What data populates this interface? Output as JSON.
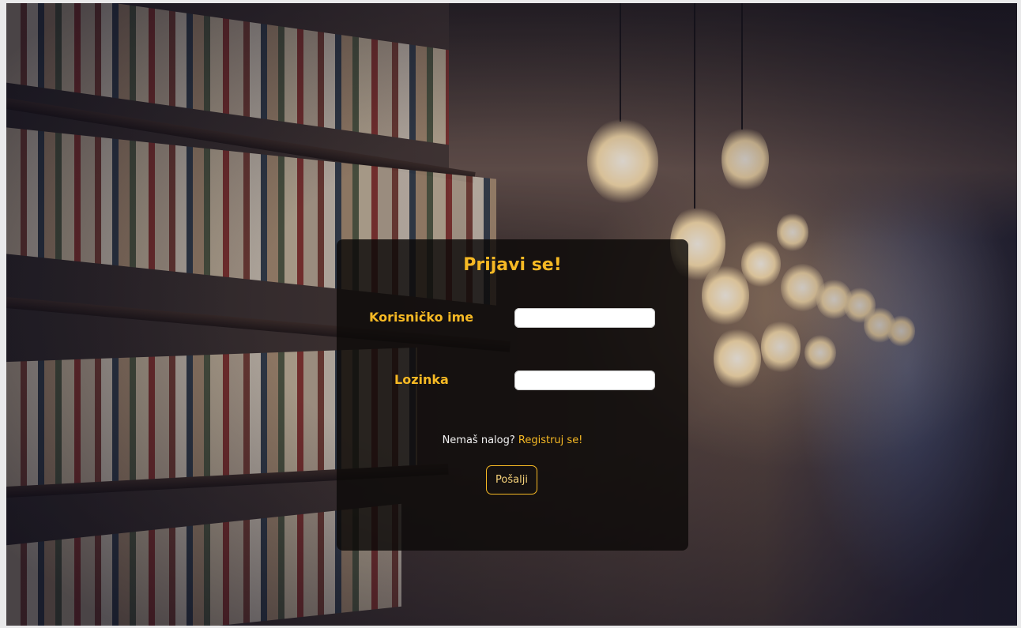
{
  "login": {
    "title": "Prijavi se!",
    "username_label": "Korisničko ime",
    "username_value": "",
    "password_label": "Lozinka",
    "password_value": "",
    "no_account_text": "Nemaš nalog?",
    "register_link": "Registruj se!",
    "submit_label": "Pošalji"
  },
  "colors": {
    "accent": "#f6b924",
    "card_background": "#0c0a08",
    "text_light": "#f2f2f2"
  }
}
